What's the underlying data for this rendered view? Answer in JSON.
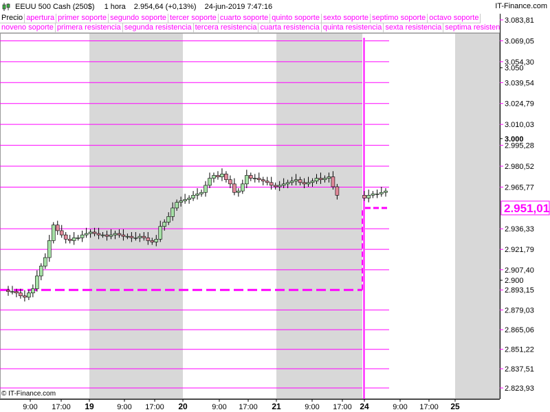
{
  "header": {
    "instrument": "EEUU 500 Cash (250$)",
    "timeframe": "1 hora",
    "quote": "2.954,64 (+0,13%)",
    "datetime": "24-jun-2019 7:47:16",
    "brand": "IT-Finance.com"
  },
  "legend": {
    "row1": [
      "Precio",
      "apertura",
      "primer soporte",
      "segundo soporte",
      "tercer soporte",
      "cuarto soporte",
      "quinto soporte",
      "sexto soporte",
      "septimo soporte",
      "octavo soporte"
    ],
    "row2": [
      "noveno soporte",
      "primera resistencia",
      "segunda resistencia",
      "tercera resistencia",
      "cuarta resistencia",
      "quinta resistencia",
      "sexta resistencia",
      "septima resistencia"
    ]
  },
  "footer": {
    "copyright": "© IT-Finance.com"
  },
  "colors": {
    "accent": "#ff00ff",
    "up_candle": "#a6e0a6",
    "down_candle": "#e08a9a",
    "shade": "#d8d8d8"
  },
  "chart_data": {
    "type": "candlestick",
    "current_price": "2.951,01",
    "y_axis": {
      "black_ticks": [
        "3.050",
        "3.000",
        "2.900"
      ],
      "level_labels": [
        "3.083,81",
        "3.069,05",
        "3.054,30",
        "3.039,54",
        "3.024,79",
        "3.010,03",
        "2.995,28",
        "2.980,52",
        "2.965,77",
        "2.936,33",
        "2.921,79",
        "2.907,40",
        "2.893,15",
        "2.879,03",
        "2.865,06",
        "2.851,22",
        "2.837,51",
        "2.823,93"
      ]
    },
    "levels": [
      3083.81,
      3069.05,
      3054.3,
      3039.54,
      3024.79,
      3010.03,
      2995.28,
      2980.52,
      2965.77,
      2951.01,
      2936.33,
      2921.79,
      2907.4,
      2893.15,
      2879.03,
      2865.06,
      2851.22,
      2837.51,
      2823.93
    ],
    "x_axis_labels": [
      "9:00",
      "17:00",
      "19",
      "9:00",
      "17:00",
      "20",
      "9:00",
      "17:00",
      "21",
      "9:00",
      "17:00",
      "24",
      "9:00",
      "17:00",
      "25"
    ],
    "apertura_previous": 2893.15,
    "apertura_current": 2951.01,
    "close_series": [
      2893,
      2892,
      2892,
      2891,
      2889,
      2888,
      2891,
      2894,
      2903,
      2910,
      2916,
      2928,
      2939,
      2935,
      2932,
      2929,
      2928,
      2930,
      2930,
      2932,
      2933,
      2934,
      2933,
      2932,
      2932,
      2931,
      2932,
      2933,
      2932,
      2931,
      2931,
      2930,
      2930,
      2931,
      2930,
      2928,
      2927,
      2929,
      2938,
      2941,
      2945,
      2951,
      2955,
      2956,
      2957,
      2958,
      2960,
      2961,
      2962,
      2967,
      2972,
      2974,
      2973,
      2975,
      2971,
      2968,
      2962,
      2963,
      2968,
      2974,
      2972,
      2972,
      2971,
      2970,
      2969,
      2967,
      2966,
      2967,
      2968,
      2969,
      2970,
      2971,
      2969,
      2968,
      2969,
      2970,
      2972,
      2971,
      2972,
      2973,
      2966,
      2960,
      2958,
      2960,
      2961,
      2961,
      2962,
      2963
    ]
  }
}
